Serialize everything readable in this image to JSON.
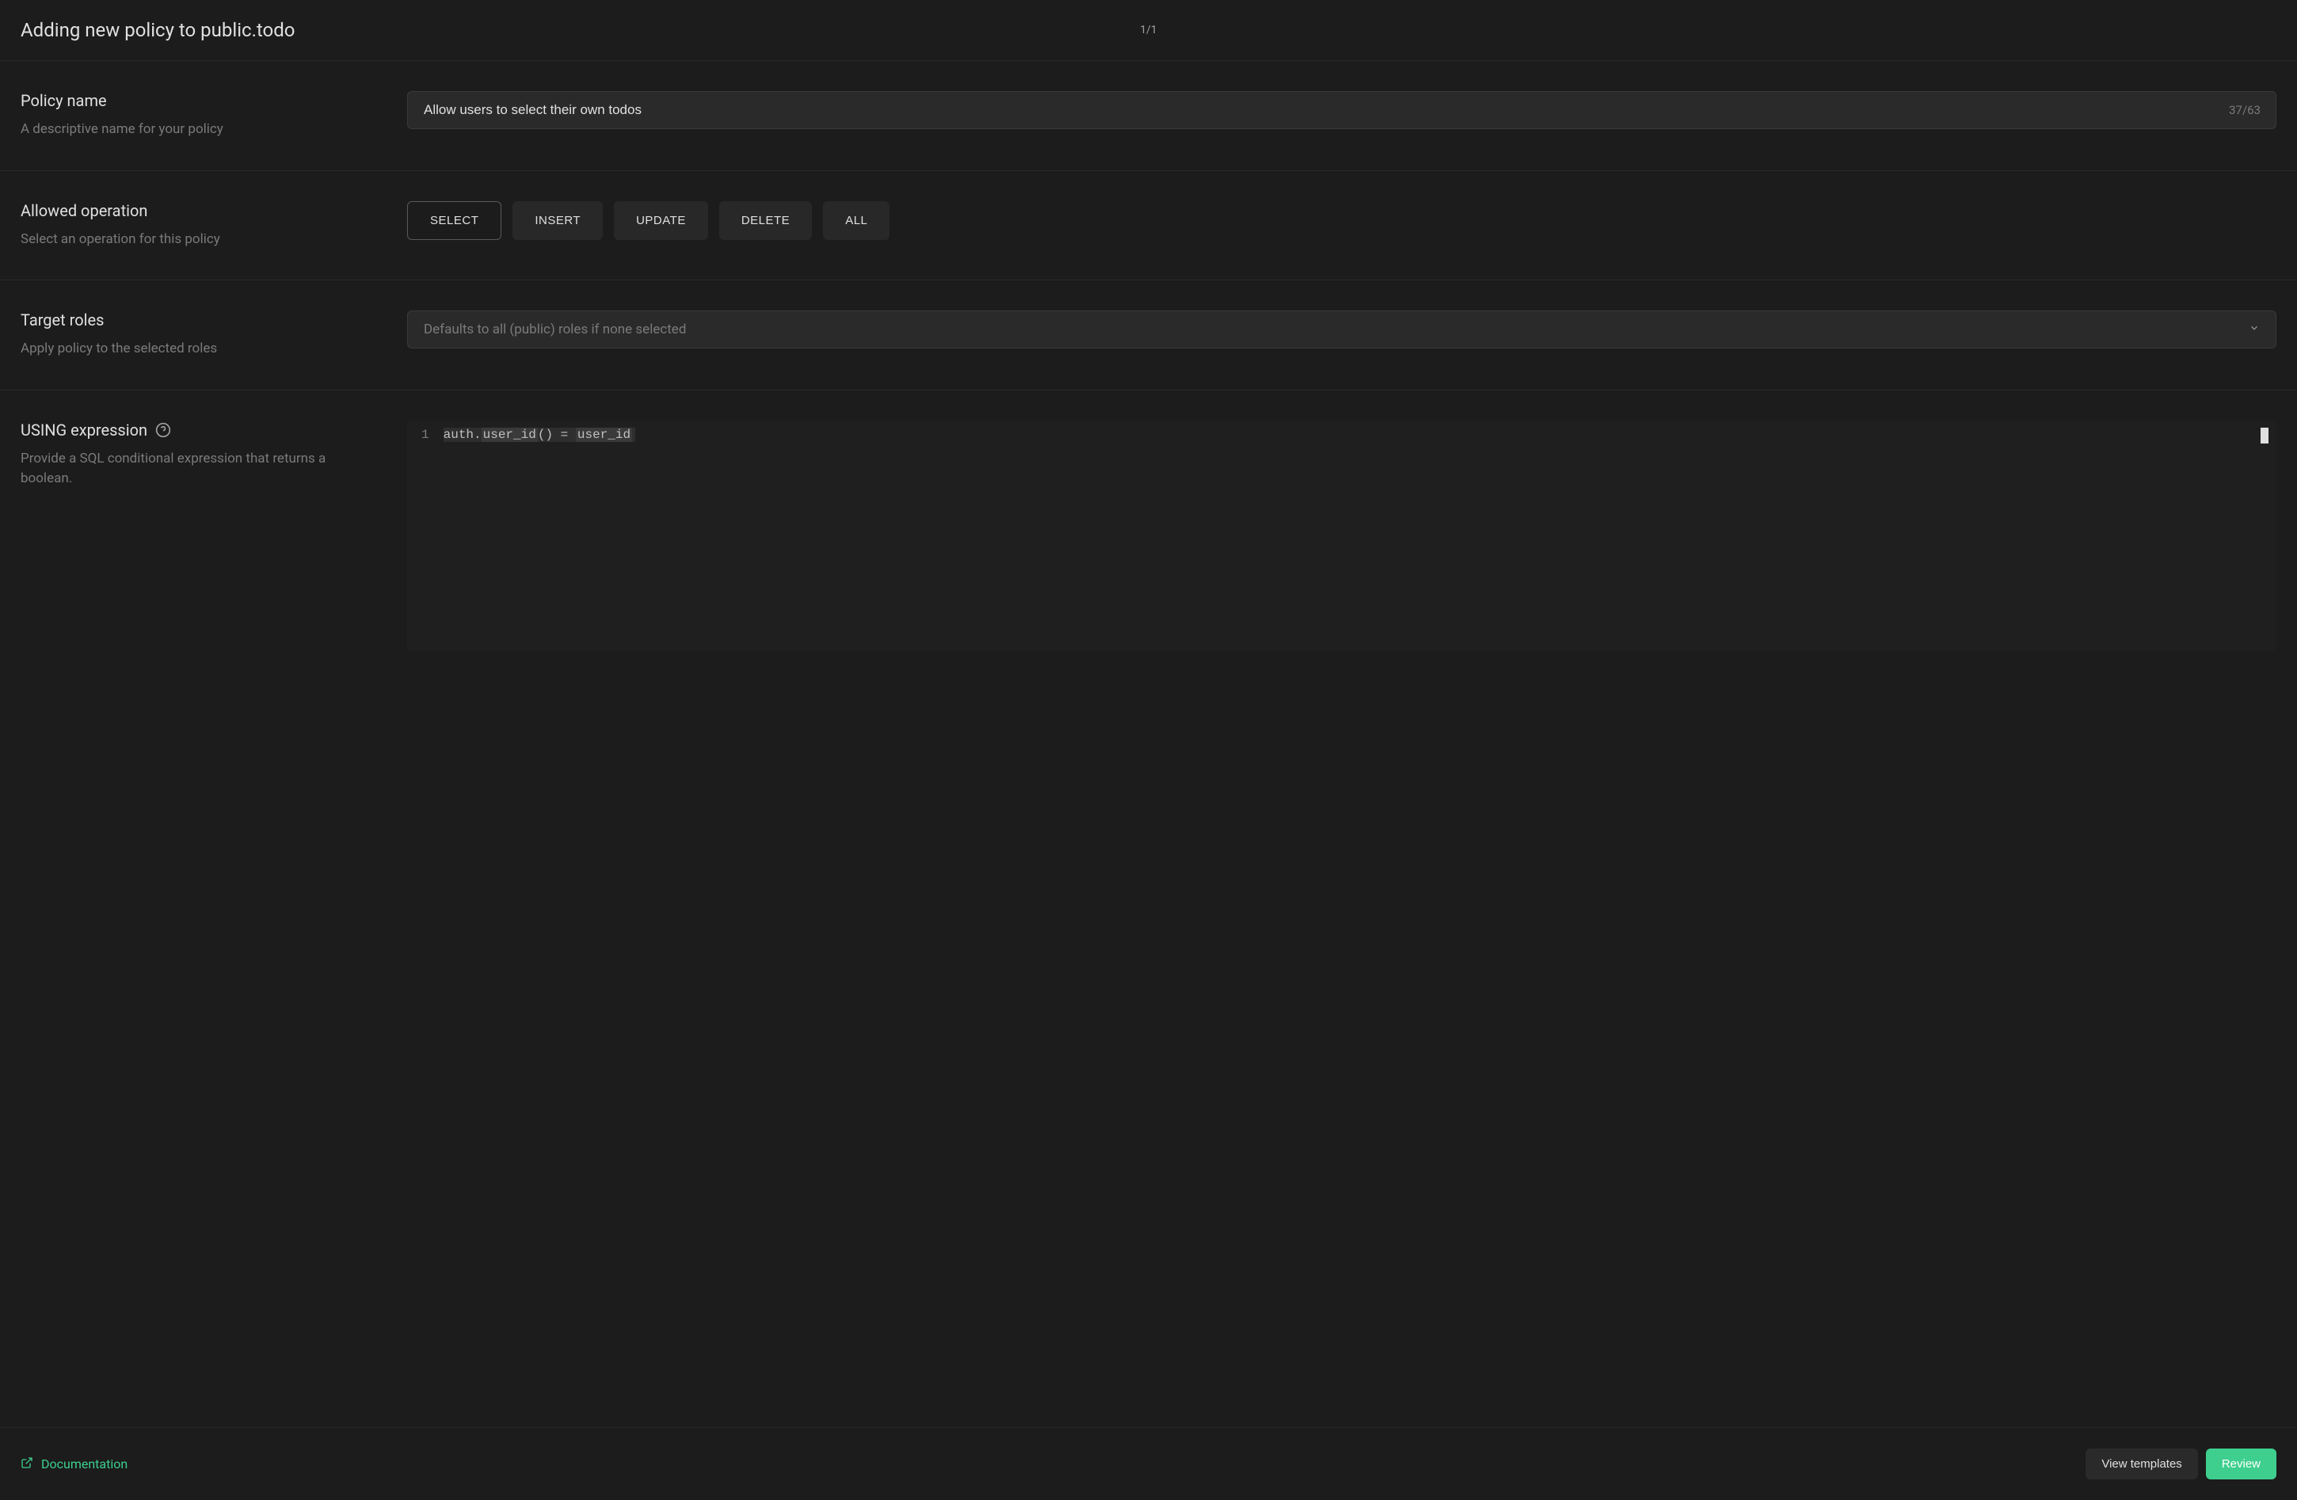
{
  "header": {
    "title": "Adding new policy to public.todo",
    "pagination": "1/1"
  },
  "policyName": {
    "label": "Policy name",
    "description": "A descriptive name for your policy",
    "value": "Allow users to select their own todos",
    "charCount": "37/63"
  },
  "allowedOperation": {
    "label": "Allowed operation",
    "description": "Select an operation for this policy",
    "options": [
      "SELECT",
      "INSERT",
      "UPDATE",
      "DELETE",
      "ALL"
    ],
    "selected": "SELECT"
  },
  "targetRoles": {
    "label": "Target roles",
    "description": "Apply policy to the selected roles",
    "placeholder": "Defaults to all (public) roles if none selected"
  },
  "usingExpression": {
    "label": "USING expression",
    "description": "Provide a SQL conditional expression that returns a boolean.",
    "lineNumber": "1",
    "code": {
      "part1": "auth.",
      "highlight1": "user_id",
      "part2": "() = ",
      "highlight2": "user_id"
    }
  },
  "footer": {
    "documentation": "Documentation",
    "viewTemplates": "View templates",
    "review": "Review"
  }
}
